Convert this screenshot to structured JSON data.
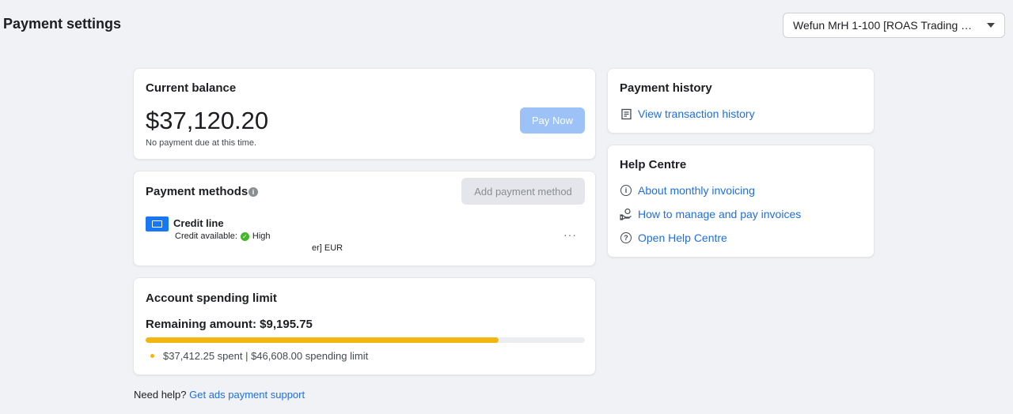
{
  "header": {
    "title": "Payment settings",
    "account_selector": "Wefun MrH 1-100 [ROAS Trading HTE..."
  },
  "balance": {
    "title": "Current balance",
    "amount": "$37,120.20",
    "note": "No payment due at this time.",
    "pay_now_label": "Pay Now"
  },
  "payment_methods": {
    "title": "Payment methods",
    "info_glyph": "i",
    "add_label": "Add payment method",
    "method": {
      "name": "Credit line",
      "available_label": "Credit available:",
      "available_value": "High",
      "currency_tail": "er] EUR",
      "more_label": "···"
    }
  },
  "spending_limit": {
    "title": "Account spending limit",
    "remaining": "Remaining amount: $9,195.75",
    "spent_text": "$37,412.25 spent | $46,608.00 spending limit",
    "progress_fraction": 0.803
  },
  "footer": {
    "need_help": "Need help?",
    "support_link": "Get ads payment support"
  },
  "payment_history": {
    "title": "Payment history",
    "link": "View transaction history"
  },
  "help_centre": {
    "title": "Help Centre",
    "links": [
      {
        "label": "About monthly invoicing",
        "icon": "info-icon"
      },
      {
        "label": "How to manage and pay invoices",
        "icon": "hand-money-icon"
      },
      {
        "label": "Open Help Centre",
        "icon": "question-icon"
      }
    ]
  },
  "colors": {
    "link": "#216fdb",
    "progress": "#f5b50f",
    "primary_disabled": "#9cc2f7",
    "credit_icon": "#1877f2",
    "check": "#42b72a"
  }
}
